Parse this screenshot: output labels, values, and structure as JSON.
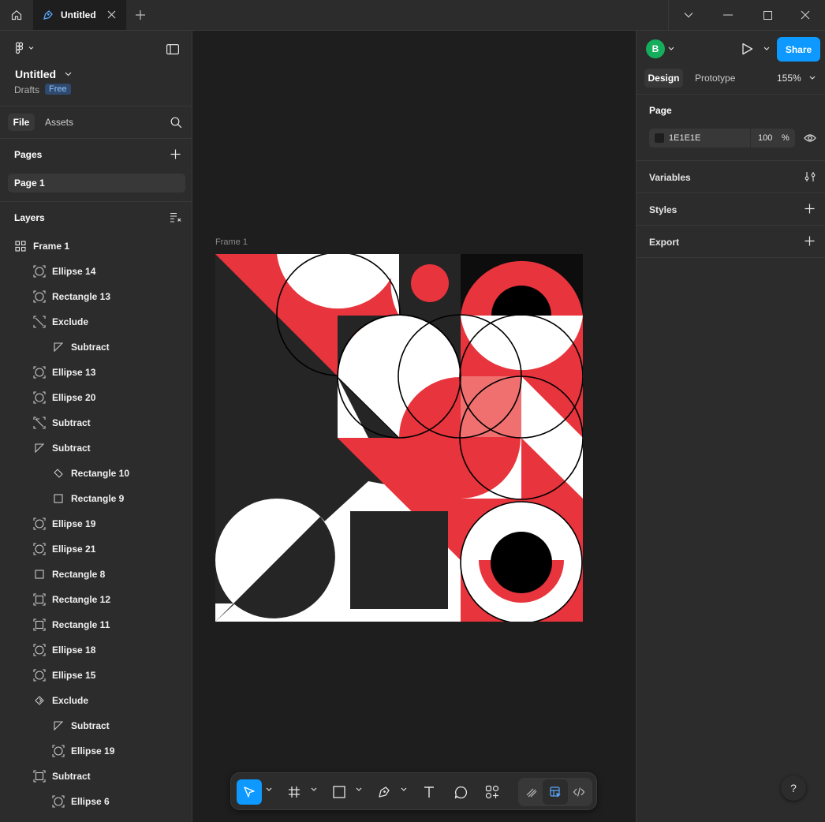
{
  "titlebar": {
    "tab_title": "Untitled"
  },
  "file": {
    "name": "Untitled",
    "location": "Drafts",
    "plan_badge": "Free"
  },
  "left_tabs": {
    "file": "File",
    "assets": "Assets"
  },
  "pages": {
    "header": "Pages",
    "items": [
      "Page 1"
    ]
  },
  "layers": {
    "header": "Layers",
    "items": [
      {
        "name": "Frame 1",
        "icon": "frame-icon",
        "depth": 0
      },
      {
        "name": "Ellipse 14",
        "icon": "ellipse-icon",
        "depth": 1
      },
      {
        "name": "Rectangle 13",
        "icon": "ellipse-icon",
        "depth": 1
      },
      {
        "name": "Exclude",
        "icon": "boolean-exclude-icon",
        "depth": 1
      },
      {
        "name": "Subtract",
        "icon": "triangle-icon",
        "depth": 2
      },
      {
        "name": "Ellipse 13",
        "icon": "ellipse-icon",
        "depth": 1
      },
      {
        "name": "Ellipse 20",
        "icon": "ellipse-icon",
        "depth": 1
      },
      {
        "name": "Subtract",
        "icon": "boolean-subtract-icon",
        "depth": 1
      },
      {
        "name": "Subtract",
        "icon": "triangle-icon",
        "depth": 1
      },
      {
        "name": "Rectangle 10",
        "icon": "rotated-rect-icon",
        "depth": 2
      },
      {
        "name": "Rectangle 9",
        "icon": "rectangle-icon",
        "depth": 2
      },
      {
        "name": "Ellipse 19",
        "icon": "ellipse-icon",
        "depth": 1
      },
      {
        "name": "Ellipse 21",
        "icon": "ellipse-icon",
        "depth": 1
      },
      {
        "name": "Rectangle 8",
        "icon": "rectangle-icon",
        "depth": 1
      },
      {
        "name": "Rectangle 12",
        "icon": "corner-rect-icon",
        "depth": 1
      },
      {
        "name": "Rectangle 11",
        "icon": "corner-rect-icon",
        "depth": 1
      },
      {
        "name": "Ellipse 18",
        "icon": "ellipse-icon",
        "depth": 1
      },
      {
        "name": "Ellipse 15",
        "icon": "ellipse-icon",
        "depth": 1
      },
      {
        "name": "Exclude",
        "icon": "boolean-exclude-small-icon",
        "depth": 1
      },
      {
        "name": "Subtract",
        "icon": "triangle-icon",
        "depth": 2
      },
      {
        "name": "Ellipse 19",
        "icon": "ellipse-icon",
        "depth": 2
      },
      {
        "name": "Subtract",
        "icon": "corner-rect-icon",
        "depth": 1
      },
      {
        "name": "Ellipse 6",
        "icon": "ellipse-icon",
        "depth": 2
      }
    ]
  },
  "canvas": {
    "frame_label": "Frame 1"
  },
  "header_right": {
    "avatar_initial": "B",
    "share_label": "Share"
  },
  "design_tabs": {
    "design": "Design",
    "prototype": "Prototype",
    "zoom": "155%"
  },
  "page_section": {
    "title": "Page",
    "color_hex": "1E1E1E",
    "opacity": "100",
    "opacity_unit": "%"
  },
  "sections": {
    "variables": "Variables",
    "styles": "Styles",
    "export": "Export"
  },
  "help_label": "?",
  "colors": {
    "accent": "#0d99ff",
    "red": "#e8343c",
    "dark": "#252525",
    "avatar": "#14ae5c"
  }
}
